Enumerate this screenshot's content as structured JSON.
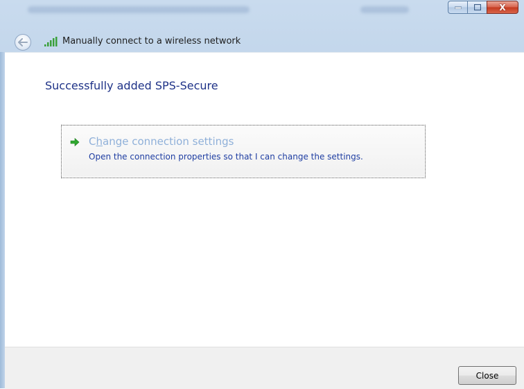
{
  "window": {
    "controls": {
      "close_glyph": "X"
    }
  },
  "nav": {
    "back_icon": "back-arrow-icon",
    "signal_icon": "wireless-signal-icon",
    "title": "Manually connect to a wireless network"
  },
  "main": {
    "heading": "Successfully added SPS-Secure",
    "command": {
      "icon": "green-arrow-icon",
      "label_pre": "C",
      "label_accel": "h",
      "label_post": "ange connection settings",
      "description": "Open the connection properties so that I can change the settings."
    }
  },
  "footer": {
    "close_label": "Close"
  },
  "colors": {
    "heading": "#1e3287",
    "command_label": "#8fb0d9",
    "command_desc": "#1f3ea2",
    "close_button": "#c43a1f"
  }
}
